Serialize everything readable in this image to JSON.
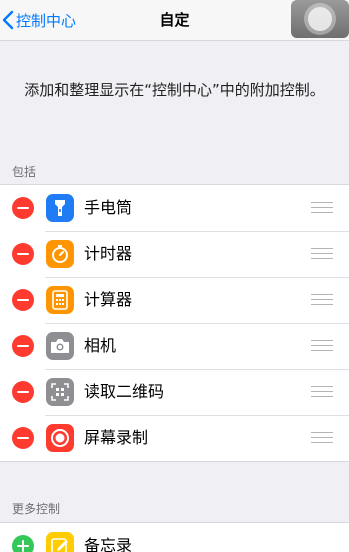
{
  "navbar": {
    "back_label": "控制中心",
    "title": "自定"
  },
  "description": "添加和整理显示在“控制中心”中的附加控制。",
  "included": {
    "header": "包括",
    "items": [
      {
        "label": "手电筒",
        "icon": "flashlight-icon",
        "icon_color": "#1f7cf4"
      },
      {
        "label": "计时器",
        "icon": "timer-icon",
        "icon_color": "#ff9500"
      },
      {
        "label": "计算器",
        "icon": "calculator-icon",
        "icon_color": "#ff9500"
      },
      {
        "label": "相机",
        "icon": "camera-icon",
        "icon_color": "#8e8e93"
      },
      {
        "label": "读取二维码",
        "icon": "qr-code-icon",
        "icon_color": "#8e8e93"
      },
      {
        "label": "屏幕录制",
        "icon": "screen-record-icon",
        "icon_color": "#ff3b30"
      }
    ]
  },
  "more": {
    "header": "更多控制",
    "items": [
      {
        "label": "备忘录",
        "icon": "notes-icon",
        "icon_color": "#ffcc00"
      }
    ]
  },
  "colors": {
    "accent": "#007aff",
    "remove": "#ff3b30",
    "add": "#34c759"
  }
}
